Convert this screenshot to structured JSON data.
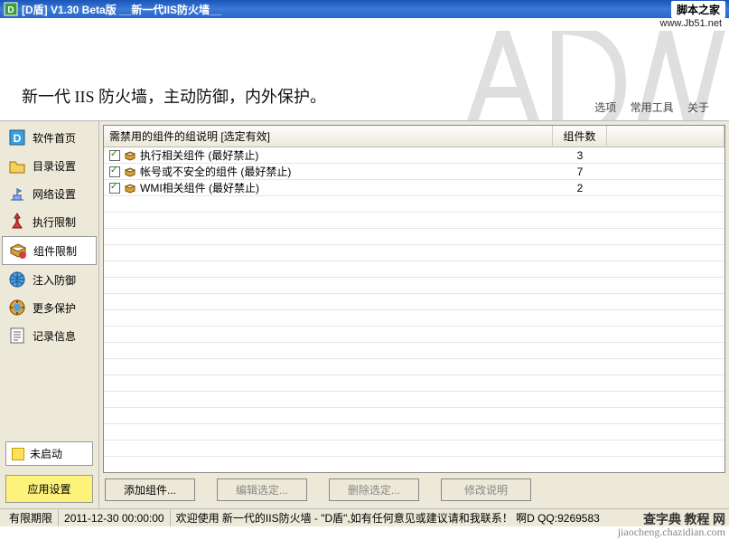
{
  "titlebar": {
    "title": "[D盾] V1.30 Beta版   __新一代IIS防火墙__",
    "branding": "脚本之家"
  },
  "url_line": "www.Jb51.net",
  "banner": {
    "slogan": "新一代 IIS 防火墙，主动防御，内外保护。",
    "menu": [
      "选项",
      "常用工具",
      "关于"
    ]
  },
  "sidebar": {
    "items": [
      {
        "label": "软件首页",
        "icon": "home"
      },
      {
        "label": "目录设置",
        "icon": "folder"
      },
      {
        "label": "网络设置",
        "icon": "network"
      },
      {
        "label": "执行限制",
        "icon": "exec"
      },
      {
        "label": "组件限制",
        "icon": "component",
        "selected": true
      },
      {
        "label": "注入防御",
        "icon": "globe"
      },
      {
        "label": "更多保护",
        "icon": "more"
      },
      {
        "label": "记录信息",
        "icon": "log"
      }
    ],
    "status_label": "未启动",
    "apply_label": "应用设置"
  },
  "listview": {
    "header_name": "需禁用的组件的组说明 [选定有效]",
    "header_count": "组件数",
    "rows": [
      {
        "checked": true,
        "name": "执行相关组件 (最好禁止)",
        "count": 3
      },
      {
        "checked": true,
        "name": "帐号或不安全的组件 (最好禁止)",
        "count": 7
      },
      {
        "checked": true,
        "name": "WMI相关组件 (最好禁止)",
        "count": 2
      }
    ]
  },
  "buttons": {
    "add": "添加组件...",
    "edit": "编辑选定...",
    "del": "删除选定...",
    "desc": "修改说明"
  },
  "statusbar": {
    "expire_label": "有限期限",
    "expire_value": "2011-12-30 00:00:00",
    "message": "欢迎使用 新一代的IIS防火墙 - \"D盾\",如有任何意见或建议请和我联系！  啊D  QQ:9269583"
  },
  "watermark": {
    "line1": "查字典  教程 网",
    "line2": "jiaocheng.chazidian.com"
  }
}
